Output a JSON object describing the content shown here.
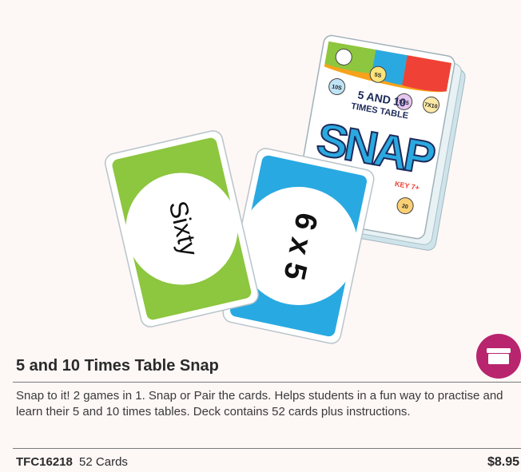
{
  "product": {
    "title": "5 and 10 Times Table Snap",
    "description": "Snap to it! 2 games in 1. Snap or Pair the cards. Helps students in a fun way to practise and learn their 5 and 10 times tables. Deck contains 52 cards plus instructions.",
    "sku": "TFC16218",
    "count": "52 Cards",
    "price": "$8.95"
  },
  "image": {
    "box_top_line1": "5 AND 10",
    "box_top_line2": "TIMES TABLE",
    "box_logo": "SNAP",
    "box_badges": [
      "5S",
      "10S",
      "5X5",
      "7X10",
      "20"
    ],
    "box_age": "KEY 7+",
    "card_left_text": "Sixty",
    "card_right_text": "6 x 5"
  },
  "colors": {
    "accent": "#b8246e",
    "card_green": "#8dc63f",
    "card_blue": "#29a9e1",
    "background": "#fdf7f6"
  },
  "icons": {
    "cart": "box-icon"
  }
}
